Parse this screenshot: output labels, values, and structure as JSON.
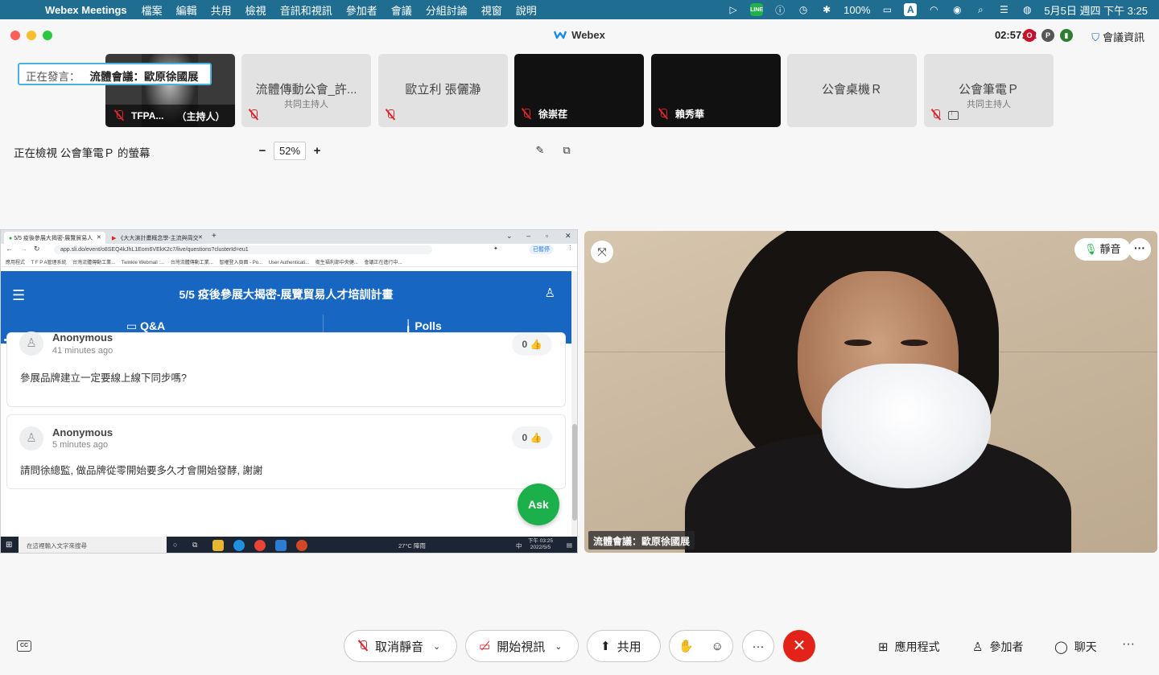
{
  "menubar": {
    "app": "Webex Meetings",
    "items": [
      "檔案",
      "編輯",
      "共用",
      "檢視",
      "音訊和視訊",
      "參加者",
      "會議",
      "分組討論",
      "視窗",
      "說明"
    ],
    "battery": "100%",
    "input_method": "A",
    "datetime": "5月5日 週四 下午 3:25"
  },
  "window": {
    "title": "Webex",
    "timer": "02:57:32",
    "meeting_info": "會議資訊"
  },
  "speaking": {
    "label": "正在發言：",
    "name": "流體會議：歐原徐國展"
  },
  "participants": [
    {
      "name": "TFPA...",
      "role": "（主持人）"
    },
    {
      "name": "流體傳動公會_許...",
      "sub": "共同主持人"
    },
    {
      "name": "歐立利 張儷瀞"
    },
    {
      "name": "徐崇荏"
    },
    {
      "name": "賴秀華"
    },
    {
      "name": "公會桌機Ｒ"
    },
    {
      "name": "公會筆電Ｐ",
      "sub": "共同主持人"
    }
  ],
  "viewing": {
    "text": "正在檢視 公會筆電Ｐ 的螢幕",
    "zoom": "52%",
    "minus": "−",
    "plus": "+"
  },
  "browser": {
    "tab1": "5/5 疫後參展大揭密-展覽貿易人",
    "tab2": "《大大演計畫概念學-主流與周交",
    "url": "app.sli.do/event/o8SEQ4kJhL1Eom6VEkK2c7/live/questions?clusterId=eu1",
    "bookmarks": [
      "應用程式",
      "T F P A管理系統",
      "台灣流體傳動工業...",
      "Twinkle Webmail :...",
      "台灣流體傳動工業...",
      "智權登入頁面 - Po...",
      "User Authenticati...",
      "衛生福利部中央健...",
      "會議正在進行中..."
    ],
    "profile": "已暫停"
  },
  "slido": {
    "event_title": "5/5 疫後參展大揭密-展覽貿易人才培訓計畫",
    "tab_qa": "Q&A",
    "tab_polls": "Polls",
    "ask": "Ask",
    "questions": [
      {
        "author": "Anonymous",
        "time": "41 minutes ago",
        "text": "參展品牌建立一定要線上線下同步嗎?",
        "likes": "0"
      },
      {
        "author": "Anonymous",
        "time": "5 minutes ago",
        "text": "請問徐總監, 做品牌從零開始要多久才會開始發酵, 謝謝",
        "likes": "0"
      }
    ]
  },
  "taskbar": {
    "search": "在這裡輸入文字來搜尋",
    "weather": "27°C  陣雨",
    "time": "下午 03:25",
    "date": "2022/5/5",
    "ime": "中"
  },
  "video": {
    "mute_label": "靜音",
    "name_label": "流體會議：歐原徐國展"
  },
  "controls": {
    "unmute": "取消靜音",
    "start_video": "開始視訊",
    "share": "共用",
    "apps": "應用程式",
    "participants": "參加者",
    "chat": "聊天",
    "cc": "CC"
  },
  "colors": {
    "menubar": "#1f6e92",
    "slido_blue": "#1767c2",
    "ask_green": "#1cb04b",
    "end_red": "#e3231a",
    "mute_red": "#d9262a"
  }
}
